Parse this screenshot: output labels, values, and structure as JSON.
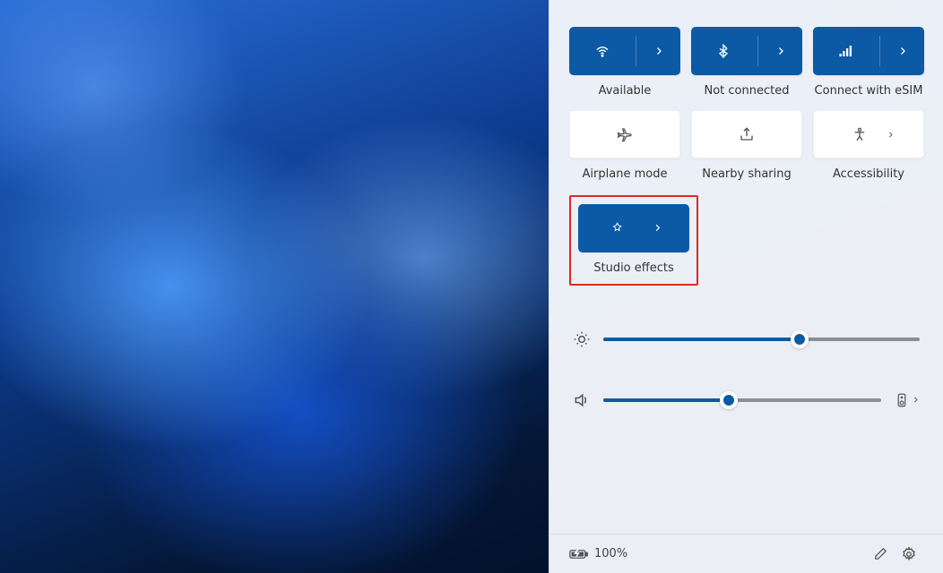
{
  "tiles": {
    "wifi": {
      "label": "Available"
    },
    "bluetooth": {
      "label": "Not connected"
    },
    "cellular": {
      "label": "Connect with eSIM"
    },
    "airplane": {
      "label": "Airplane mode"
    },
    "nearby": {
      "label": "Nearby sharing"
    },
    "accessibility": {
      "label": "Accessibility"
    },
    "studio": {
      "label": "Studio effects"
    }
  },
  "sliders": {
    "brightness": {
      "value": 62
    },
    "volume": {
      "value": 45
    }
  },
  "battery": {
    "text": "100%"
  },
  "colors": {
    "accent": "#0c5aa6",
    "highlight": "#e2291f"
  }
}
